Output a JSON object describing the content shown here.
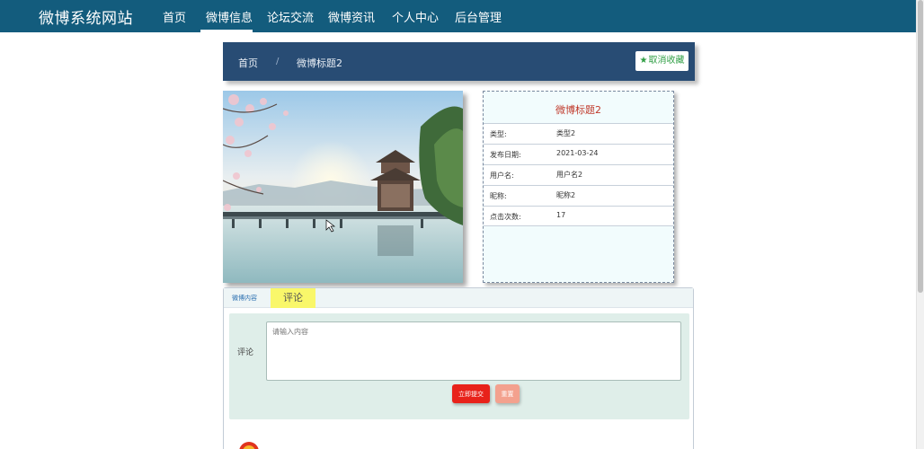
{
  "nav": {
    "brand": "微博系统网站",
    "items": [
      {
        "label": "首页"
      },
      {
        "label": "微博信息"
      },
      {
        "label": "论坛交流"
      },
      {
        "label": "微博资讯"
      },
      {
        "label": "个人中心"
      },
      {
        "label": "后台管理"
      }
    ],
    "active_index": 1
  },
  "breadcrumb": {
    "home": "首页",
    "separator": "/",
    "current": "微博标题2"
  },
  "favorite": {
    "icon": "star-icon",
    "label": "取消收藏",
    "color": "#2f9e44"
  },
  "detail": {
    "title": "微博标题2",
    "rows": [
      {
        "key": "类型:",
        "value": "类型2"
      },
      {
        "key": "发布日期:",
        "value": "2021-03-24"
      },
      {
        "key": "用户名:",
        "value": "用户名2"
      },
      {
        "key": "昵称:",
        "value": "昵称2"
      },
      {
        "key": "点击次数:",
        "value": "17"
      }
    ]
  },
  "tabs": {
    "content_label": "微博内容",
    "comment_label": "评论",
    "active": "评论"
  },
  "comment_form": {
    "label": "评论",
    "placeholder": "请输入内容",
    "value": "",
    "submit_label": "立即提交",
    "reset_label": "重置"
  },
  "colors": {
    "navbar": "#135c7d",
    "breadcrumb": "#284c74",
    "title_red": "#c0392b",
    "submit": "#e8221a",
    "reset": "#f3a18e",
    "tab_highlight": "#f9f76a"
  }
}
